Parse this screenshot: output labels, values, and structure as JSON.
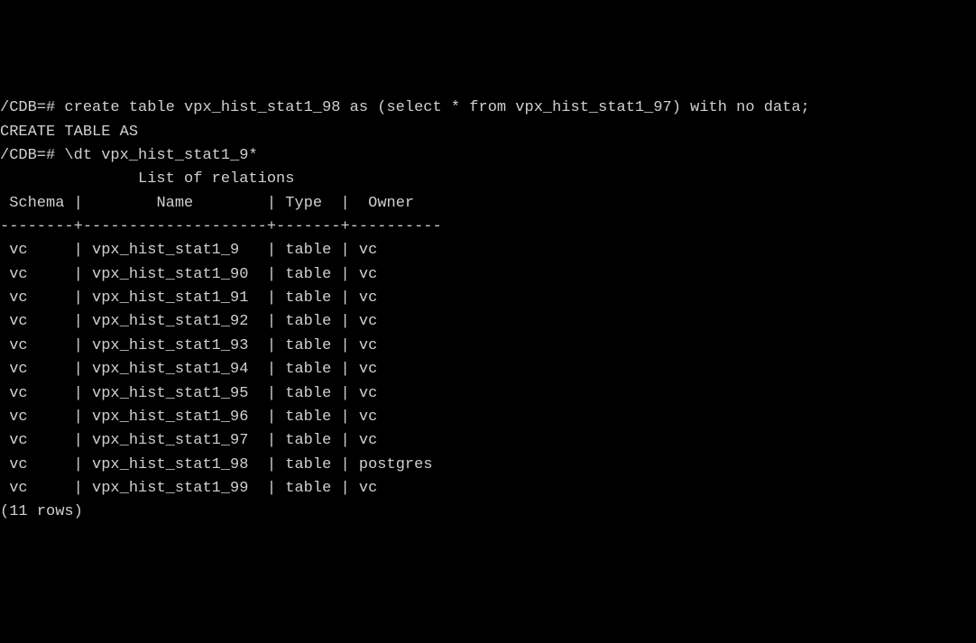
{
  "prompt": "/CDB=#",
  "cmd_create": "create table vpx_hist_stat1_98 as (select * from vpx_hist_stat1_97) with no data;",
  "response_create": "CREATE TABLE AS",
  "cmd_dt": "\\dt vpx_hist_stat1_9*",
  "list_title": "List of relations",
  "headers": {
    "schema": "Schema",
    "name": "Name",
    "type": "Type",
    "owner": "Owner"
  },
  "rows": [
    {
      "schema": "vc",
      "name": "vpx_hist_stat1_9",
      "type": "table",
      "owner": "vc"
    },
    {
      "schema": "vc",
      "name": "vpx_hist_stat1_90",
      "type": "table",
      "owner": "vc"
    },
    {
      "schema": "vc",
      "name": "vpx_hist_stat1_91",
      "type": "table",
      "owner": "vc"
    },
    {
      "schema": "vc",
      "name": "vpx_hist_stat1_92",
      "type": "table",
      "owner": "vc"
    },
    {
      "schema": "vc",
      "name": "vpx_hist_stat1_93",
      "type": "table",
      "owner": "vc"
    },
    {
      "schema": "vc",
      "name": "vpx_hist_stat1_94",
      "type": "table",
      "owner": "vc"
    },
    {
      "schema": "vc",
      "name": "vpx_hist_stat1_95",
      "type": "table",
      "owner": "vc"
    },
    {
      "schema": "vc",
      "name": "vpx_hist_stat1_96",
      "type": "table",
      "owner": "vc"
    },
    {
      "schema": "vc",
      "name": "vpx_hist_stat1_97",
      "type": "table",
      "owner": "vc"
    },
    {
      "schema": "vc",
      "name": "vpx_hist_stat1_98",
      "type": "table",
      "owner": "postgres"
    },
    {
      "schema": "vc",
      "name": "vpx_hist_stat1_99",
      "type": "table",
      "owner": "vc"
    }
  ],
  "row_count_text": "(11 rows)"
}
